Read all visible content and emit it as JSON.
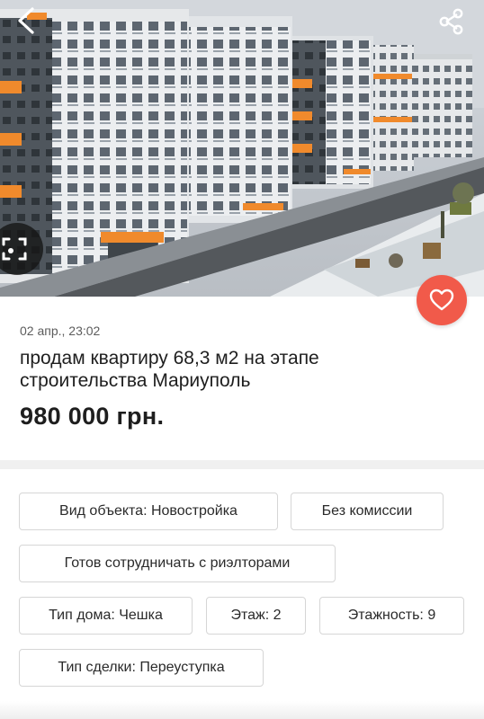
{
  "listing": {
    "date": "02 апр., 23:02",
    "title": "продам квартиру 68,3 м2 на этапе строительства Мариуполь",
    "price": "980 000 грн."
  },
  "tags": [
    "Вид объекта: Новостройка",
    "Без комиссии",
    "Готов сотрудничать с риэлторами",
    "Тип дома: Чешка",
    "Этаж: 2",
    "Этажность: 9",
    "Тип сделки: Переуступка"
  ],
  "icons": {
    "back": "chevron-left-icon",
    "share": "share-icon",
    "gallery": "gallery-icon",
    "favorite": "heart-icon"
  },
  "colors": {
    "accent": "#f15a4a",
    "building_trim": "#f08a2c"
  }
}
